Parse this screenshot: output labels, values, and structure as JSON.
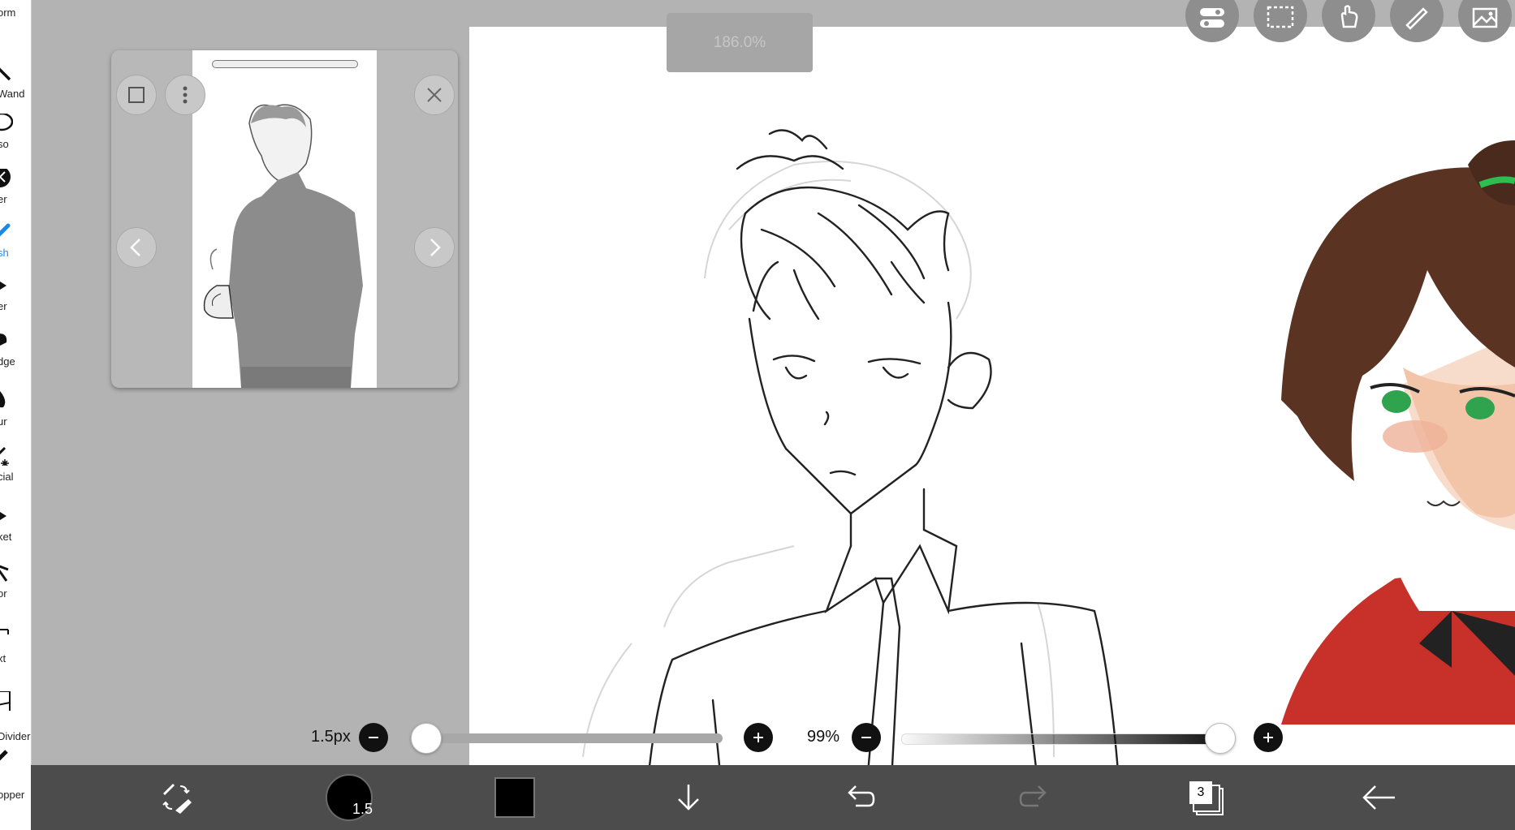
{
  "toolbar_left": {
    "tools": [
      {
        "label": "orm"
      },
      {
        "label": "Wand"
      },
      {
        "label": "so"
      },
      {
        "label": "er"
      },
      {
        "label": "sh",
        "active": true
      },
      {
        "label": "er"
      },
      {
        "label": "dge"
      },
      {
        "label": "ur"
      },
      {
        "label": "cial"
      },
      {
        "label": "ket"
      },
      {
        "label": "or"
      },
      {
        "label": "xt"
      },
      {
        "label": "Divider"
      },
      {
        "label": "opper"
      }
    ]
  },
  "zoom": {
    "value": "186.0%"
  },
  "brush_size": {
    "label": "1.5px",
    "value_fraction": 0.0
  },
  "opacity": {
    "label": "99%",
    "value_fraction": 0.99
  },
  "bottombar": {
    "brush_size_badge": "1.5",
    "current_color": "#000000",
    "layer_count": "3"
  },
  "colors": {
    "accent": "#1e88e5",
    "bottom_bar": "#4c4c4c",
    "workspace": "#b3b3b3"
  }
}
